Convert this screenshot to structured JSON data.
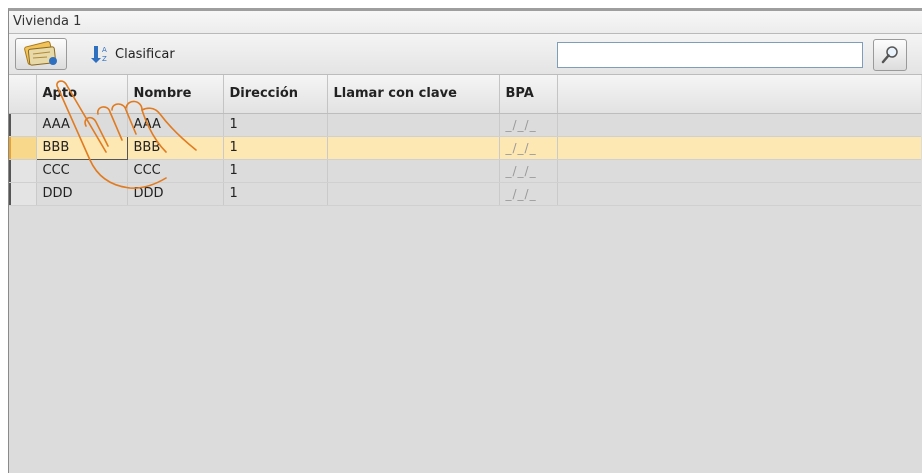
{
  "window": {
    "title": "Vivienda 1"
  },
  "toolbar": {
    "new_button_icon": "new-record-icon",
    "sort_icon": "sort-az-icon",
    "sort_label": "Clasificar",
    "search_value": "",
    "search_icon": "magnifier-icon"
  },
  "table": {
    "columns": [
      "Apto",
      "Nombre",
      "Dirección",
      "Llamar con clave",
      "BPA"
    ],
    "rows": [
      {
        "apto": "AAA",
        "nombre": "AAA",
        "direccion": "1",
        "llamar": "",
        "bpa": "_/_/_"
      },
      {
        "apto": "BBB",
        "nombre": "BBB",
        "direccion": "1",
        "llamar": "",
        "bpa": "_/_/_"
      },
      {
        "apto": "CCC",
        "nombre": "CCC",
        "direccion": "1",
        "llamar": "",
        "bpa": "_/_/_"
      },
      {
        "apto": "DDD",
        "nombre": "DDD",
        "direccion": "1",
        "llamar": "",
        "bpa": "_/_/_"
      }
    ],
    "selected_row": 1
  },
  "colors": {
    "selected_row": "#fde7b3",
    "hand_outline": "#e07b20"
  }
}
